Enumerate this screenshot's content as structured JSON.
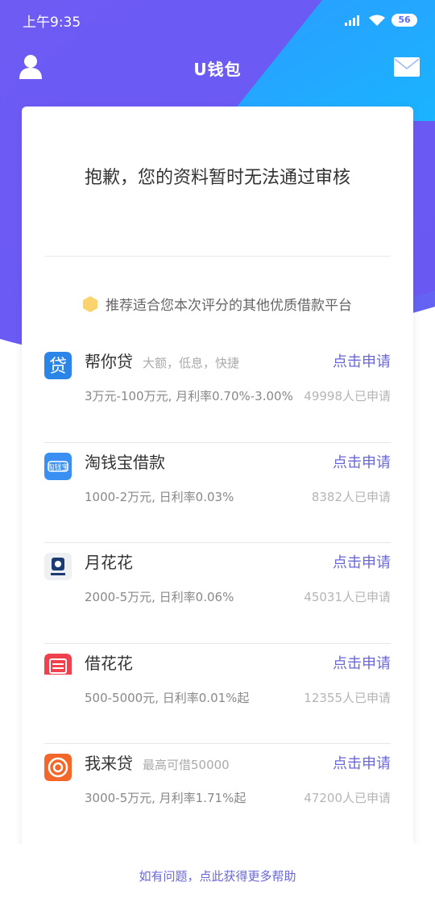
{
  "status_bar": {
    "time": "上午9:35",
    "battery": "56"
  },
  "header": {
    "title": "U钱包"
  },
  "card": {
    "headline": "抱歉，您的资料暂时无法通过审核",
    "recommend_text": "推荐适合您本次评分的其他优质借款平台"
  },
  "loans": [
    {
      "name": "帮你贷",
      "tagline": "大额，低息，快捷",
      "apply": "点击申请",
      "terms": "3万元-100万元, 月利率0.70%-3.00%",
      "count": "49998人已申请"
    },
    {
      "name": "淘钱宝借款",
      "tagline": "",
      "apply": "点击申请",
      "terms": "1000-2万元, 日利率0.03%",
      "count": "8382人已申请"
    },
    {
      "name": "月花花",
      "tagline": "",
      "apply": "点击申请",
      "terms": "2000-5万元, 日利率0.06%",
      "count": "45031人已申请"
    },
    {
      "name": "借花花",
      "tagline": "",
      "apply": "点击申请",
      "terms": "500-5000元, 日利率0.01%起",
      "count": "12355人已申请"
    },
    {
      "name": "我来贷",
      "tagline": "最高可借50000",
      "apply": "点击申请",
      "terms": "3000-5万元, 月利率1.71%起",
      "count": "47200人已申请"
    }
  ],
  "footer": {
    "help": "如有问题，点此获得更多帮助"
  },
  "colors": {
    "accent": "#6a67d8",
    "gradient_start": "#5561f5",
    "gradient_end": "#19b0ff"
  }
}
